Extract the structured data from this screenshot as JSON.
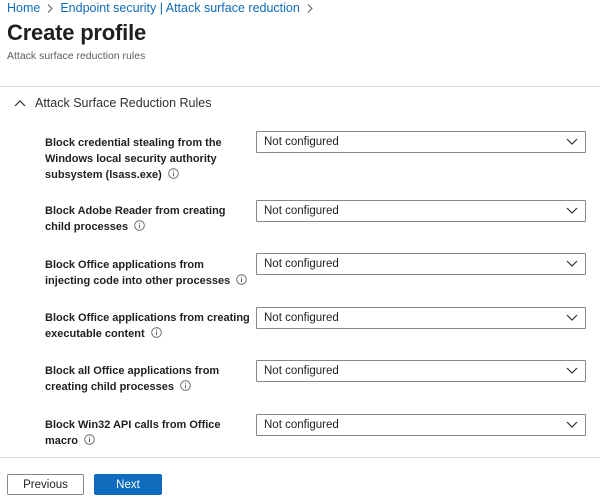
{
  "breadcrumb": {
    "items": [
      "Home",
      "Endpoint security | Attack surface reduction"
    ]
  },
  "page": {
    "title": "Create profile",
    "subtitle": "Attack surface reduction rules"
  },
  "section": {
    "title": "Attack Surface Reduction Rules",
    "expanded": true
  },
  "rules": [
    {
      "label": "Block credential stealing from the Windows local security authority subsystem (lsass.exe)",
      "value": "Not configured"
    },
    {
      "label": "Block Adobe Reader from creating child processes",
      "value": "Not configured"
    },
    {
      "label": "Block Office applications from injecting code into other processes",
      "value": "Not configured"
    },
    {
      "label": "Block Office applications from creating executable content",
      "value": "Not configured"
    },
    {
      "label": "Block all Office applications from creating child processes",
      "value": "Not configured"
    },
    {
      "label": "Block Win32 API calls from Office macro",
      "value": "Not configured"
    }
  ],
  "footer": {
    "previous_label": "Previous",
    "next_label": "Next"
  },
  "colors": {
    "accent": "#0f6cbd",
    "text": "#201f1e",
    "border": "#8a8886",
    "divider": "#e1dfdd"
  }
}
